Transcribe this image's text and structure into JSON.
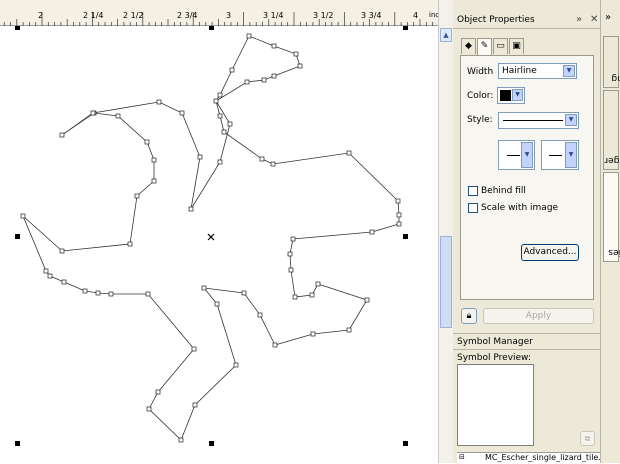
{
  "ruler": {
    "labels": [
      {
        "text": "2",
        "key": "r0"
      },
      {
        "text": "2 1/4",
        "key": "r1"
      },
      {
        "text": "2 1/2",
        "key": "r2"
      },
      {
        "text": "2 3/4",
        "key": "r3"
      },
      {
        "text": "3",
        "key": "r4"
      },
      {
        "text": "3 1/4",
        "key": "r5"
      },
      {
        "text": "3 1/2",
        "key": "r6"
      },
      {
        "text": "3 3/4",
        "key": "r7"
      },
      {
        "text": "4",
        "key": "r8"
      }
    ],
    "unit": "inches"
  },
  "object_properties": {
    "title": "Object Properties",
    "width_label": "Width",
    "width_value": "Hairline",
    "color_label": "Color:",
    "color_value": "#000000",
    "style_label": "Style:",
    "behind_fill_label": "Behind fill",
    "scale_with_image_label": "Scale with image",
    "advanced_label": "Advanced...",
    "apply_label": "Apply"
  },
  "symbol_manager": {
    "title": "Symbol Manager",
    "preview_label": "Symbol Preview:",
    "file_name": "MC_Escher_single_lizard_tile.CDR"
  },
  "side_tabs": {
    "shaping": "Shaping",
    "object_manager": "Object Manager",
    "object_properties": "Object Properties"
  },
  "colors": {
    "accent": "#003c74",
    "panel_bg": "#ece9d8",
    "ruler_bg": "#f4f1e4"
  }
}
